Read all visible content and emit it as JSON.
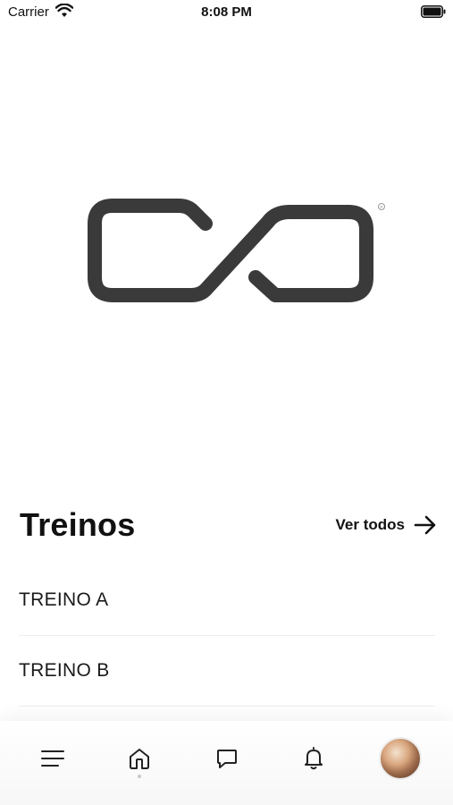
{
  "status_bar": {
    "carrier": "Carrier",
    "time": "8:08 PM",
    "wifi_icon": "wifi-icon",
    "battery_icon": "battery-icon"
  },
  "logo": {
    "icon": "brand-logo",
    "color": "#3a3a3a"
  },
  "workouts": {
    "title": "Treinos",
    "see_all_label": "Ver todos",
    "see_all_icon": "arrow-right-icon",
    "items": [
      {
        "label": "TREINO A"
      },
      {
        "label": "TREINO B"
      }
    ]
  },
  "tab_bar": {
    "items": [
      {
        "icon": "menu-icon"
      },
      {
        "icon": "home-icon",
        "active": true
      },
      {
        "icon": "chat-icon"
      },
      {
        "icon": "bell-icon"
      },
      {
        "icon": "avatar"
      }
    ]
  }
}
